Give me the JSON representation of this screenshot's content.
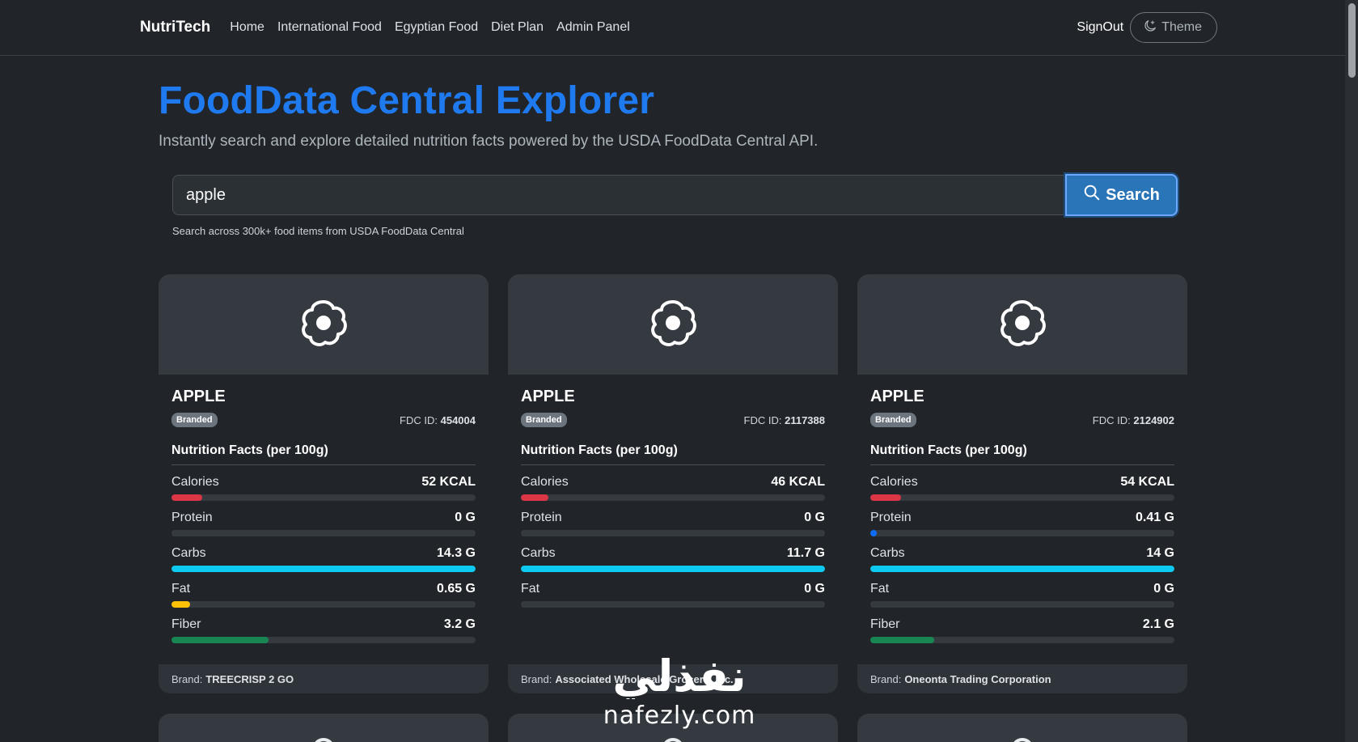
{
  "nav": {
    "brand": "NutriTech",
    "links": [
      "Home",
      "International Food",
      "Egyptian Food",
      "Diet Plan",
      "Admin Panel"
    ],
    "signout": "SignOut",
    "theme": "Theme"
  },
  "hero": {
    "title": "FoodData Central Explorer",
    "subtitle": "Instantly search and explore detailed nutrition facts powered by the USDA FoodData Central API."
  },
  "search": {
    "value": "apple",
    "button": "Search",
    "help": "Search across 300k+ food items from USDA FoodData Central"
  },
  "colors": {
    "calories": "#dc3545",
    "protein": "#0d6efd",
    "carbs": "#0dcaf0",
    "fat": "#ffc107",
    "fiber": "#198754"
  },
  "cards": [
    {
      "title": "APPLE",
      "badge": "Branded",
      "fdc_label": "FDC ID:",
      "fdc_id": "454004",
      "facts_title": "Nutrition Facts (per 100g)",
      "nutrients": [
        {
          "name": "Calories",
          "value": "52 KCAL",
          "pct": 10,
          "color": "#dc3545"
        },
        {
          "name": "Protein",
          "value": "0 G",
          "pct": 0,
          "color": "#0d6efd"
        },
        {
          "name": "Carbs",
          "value": "14.3 G",
          "pct": 100,
          "color": "#0dcaf0"
        },
        {
          "name": "Fat",
          "value": "0.65 G",
          "pct": 6,
          "color": "#ffc107"
        },
        {
          "name": "Fiber",
          "value": "3.2 G",
          "pct": 32,
          "color": "#198754"
        }
      ],
      "brand_label": "Brand:",
      "brand": "TREECRISP 2 GO"
    },
    {
      "title": "APPLE",
      "badge": "Branded",
      "fdc_label": "FDC ID:",
      "fdc_id": "2117388",
      "facts_title": "Nutrition Facts (per 100g)",
      "nutrients": [
        {
          "name": "Calories",
          "value": "46 KCAL",
          "pct": 9,
          "color": "#dc3545"
        },
        {
          "name": "Protein",
          "value": "0 G",
          "pct": 0,
          "color": "#0d6efd"
        },
        {
          "name": "Carbs",
          "value": "11.7 G",
          "pct": 100,
          "color": "#0dcaf0"
        },
        {
          "name": "Fat",
          "value": "0 G",
          "pct": 0,
          "color": "#ffc107"
        }
      ],
      "brand_label": "Brand:",
      "brand": "Associated Wholesale Grocers, Inc."
    },
    {
      "title": "APPLE",
      "badge": "Branded",
      "fdc_label": "FDC ID:",
      "fdc_id": "2124902",
      "facts_title": "Nutrition Facts (per 100g)",
      "nutrients": [
        {
          "name": "Calories",
          "value": "54 KCAL",
          "pct": 10,
          "color": "#dc3545"
        },
        {
          "name": "Protein",
          "value": "0.41 G",
          "pct": 2,
          "color": "#0d6efd"
        },
        {
          "name": "Carbs",
          "value": "14 G",
          "pct": 100,
          "color": "#0dcaf0"
        },
        {
          "name": "Fat",
          "value": "0 G",
          "pct": 0,
          "color": "#ffc107"
        },
        {
          "name": "Fiber",
          "value": "2.1 G",
          "pct": 21,
          "color": "#198754"
        }
      ],
      "brand_label": "Brand:",
      "brand": "Oneonta Trading Corporation"
    }
  ],
  "watermark": {
    "logo_text": "نفذلي",
    "text": "nafezly.com"
  }
}
